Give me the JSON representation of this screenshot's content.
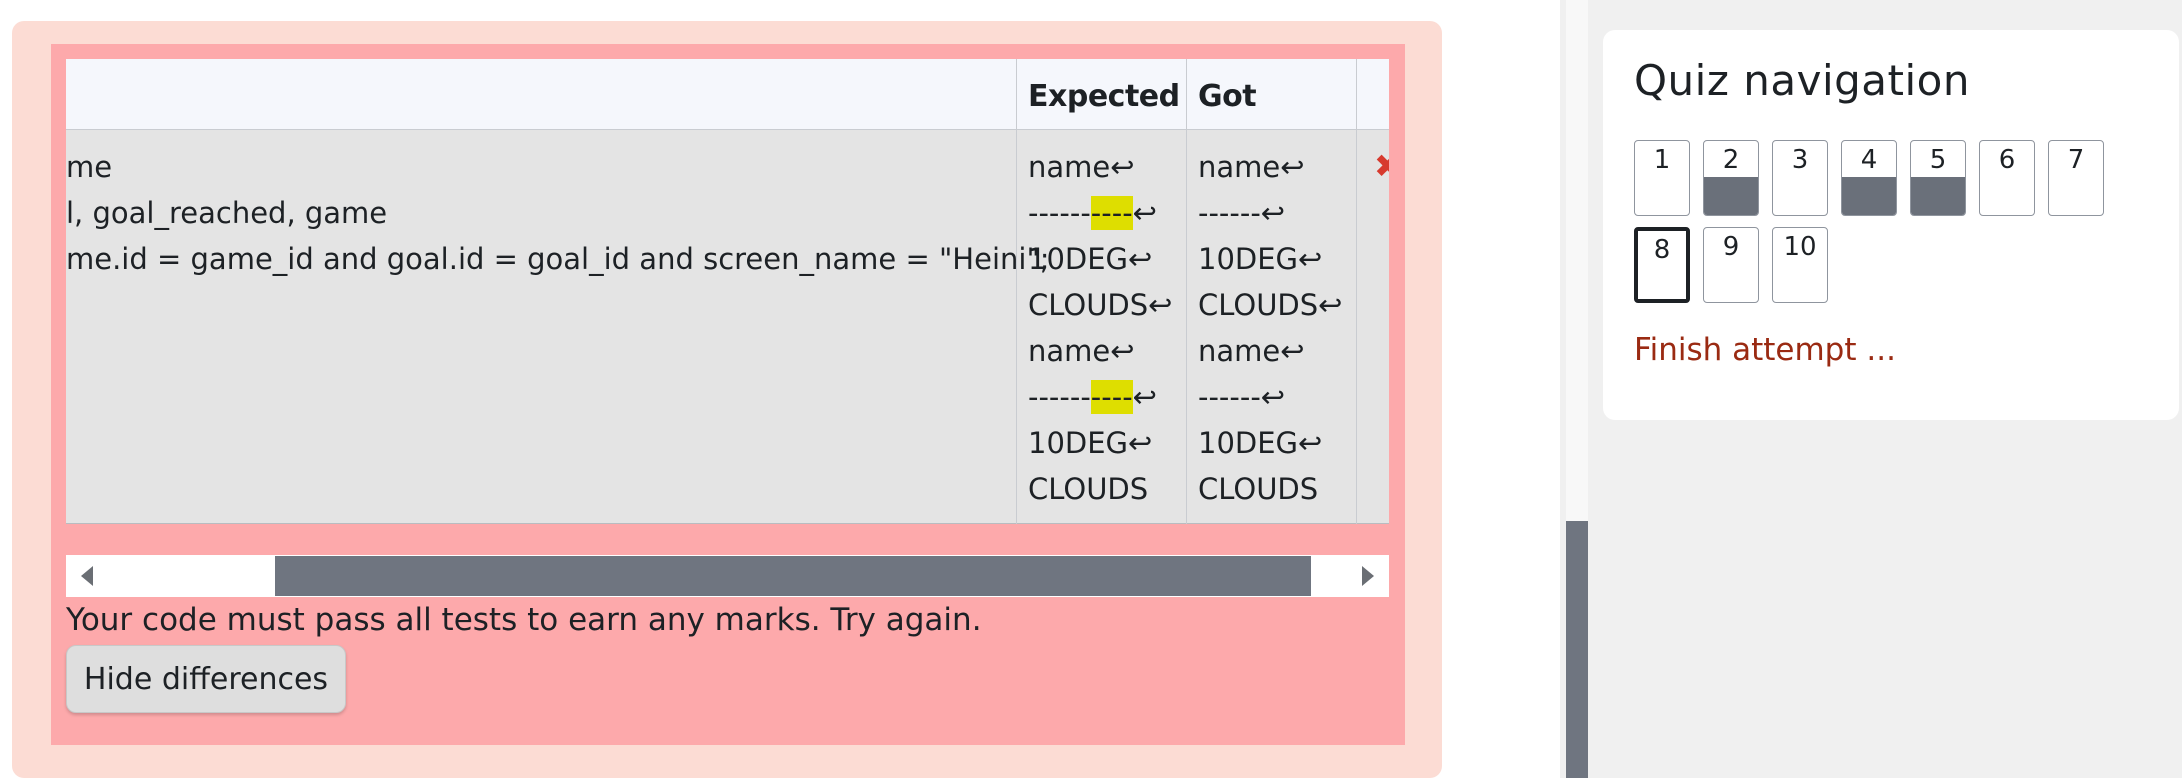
{
  "table": {
    "headers": {
      "test": "",
      "expected": "Expected",
      "got": "Got"
    },
    "test_lines": [
      "me",
      "l, goal_reached, game",
      "me.id = game_id and goal.id = goal_id and screen_name = \"Heini\";",
      "",
      "",
      "",
      "",
      ""
    ],
    "expected_lines": [
      {
        "pre": "name↩",
        "hl": "",
        "post": ""
      },
      {
        "pre": "------",
        "hl": "----",
        "post": "↩"
      },
      {
        "pre": "10DEG↩",
        "hl": "",
        "post": ""
      },
      {
        "pre": "CLOUDS↩",
        "hl": "",
        "post": ""
      },
      {
        "pre": "name↩",
        "hl": "",
        "post": ""
      },
      {
        "pre": "------",
        "hl": "----",
        "post": "↩"
      },
      {
        "pre": "10DEG↩",
        "hl": "",
        "post": ""
      },
      {
        "pre": "CLOUDS",
        "hl": "",
        "post": ""
      }
    ],
    "got_lines": [
      "name↩",
      "------↩",
      "10DEG↩",
      "CLOUDS↩",
      "name↩",
      "------↩",
      "10DEG↩",
      "CLOUDS"
    ],
    "fail_icon": "cross-icon"
  },
  "message": "Your code must pass all tests to earn any marks. Try again.",
  "hide_button_label": "Hide differences",
  "quiz_nav": {
    "title": "Quiz navigation",
    "questions": [
      {
        "label": "1",
        "answered": false,
        "current": false
      },
      {
        "label": "2",
        "answered": true,
        "current": false
      },
      {
        "label": "3",
        "answered": false,
        "current": false
      },
      {
        "label": "4",
        "answered": true,
        "current": false
      },
      {
        "label": "5",
        "answered": true,
        "current": false
      },
      {
        "label": "6",
        "answered": false,
        "current": false
      },
      {
        "label": "7",
        "answered": false,
        "current": false
      },
      {
        "label": "8",
        "answered": false,
        "current": true
      },
      {
        "label": "9",
        "answered": false,
        "current": false
      },
      {
        "label": "10",
        "answered": false,
        "current": false
      }
    ],
    "finish_label": "Finish attempt ..."
  },
  "colors": {
    "outcome_bg": "#fcdcd4",
    "feedback_bg": "#fda9ab",
    "diff_highlight": "#dede00",
    "answered_fill": "#6a707a",
    "finish_link": "#9a2a12"
  }
}
